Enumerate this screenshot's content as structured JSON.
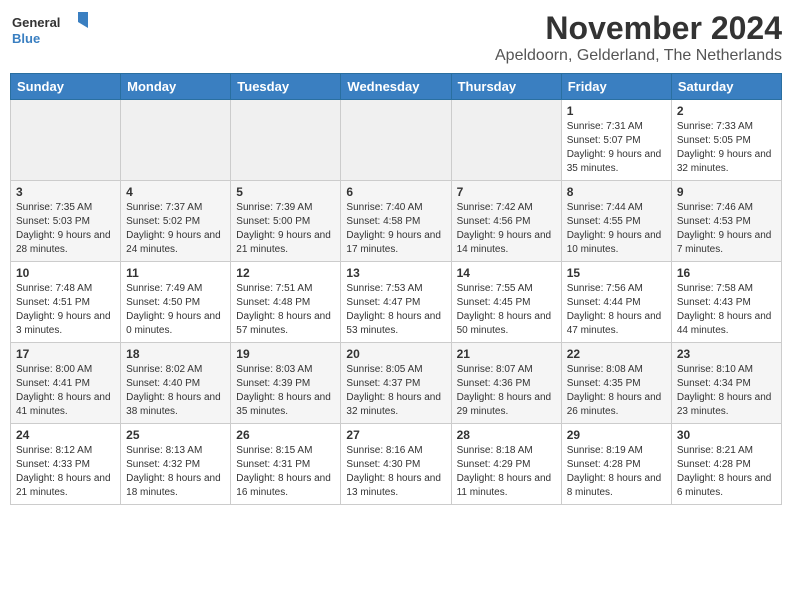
{
  "logo": {
    "line1": "General",
    "line2": "Blue"
  },
  "title": "November 2024",
  "location": "Apeldoorn, Gelderland, The Netherlands",
  "days_of_week": [
    "Sunday",
    "Monday",
    "Tuesday",
    "Wednesday",
    "Thursday",
    "Friday",
    "Saturday"
  ],
  "weeks": [
    [
      {
        "day": "",
        "info": "",
        "empty": true
      },
      {
        "day": "",
        "info": "",
        "empty": true
      },
      {
        "day": "",
        "info": "",
        "empty": true
      },
      {
        "day": "",
        "info": "",
        "empty": true
      },
      {
        "day": "",
        "info": "",
        "empty": true
      },
      {
        "day": "1",
        "info": "Sunrise: 7:31 AM\nSunset: 5:07 PM\nDaylight: 9 hours and 35 minutes."
      },
      {
        "day": "2",
        "info": "Sunrise: 7:33 AM\nSunset: 5:05 PM\nDaylight: 9 hours and 32 minutes."
      }
    ],
    [
      {
        "day": "3",
        "info": "Sunrise: 7:35 AM\nSunset: 5:03 PM\nDaylight: 9 hours and 28 minutes."
      },
      {
        "day": "4",
        "info": "Sunrise: 7:37 AM\nSunset: 5:02 PM\nDaylight: 9 hours and 24 minutes."
      },
      {
        "day": "5",
        "info": "Sunrise: 7:39 AM\nSunset: 5:00 PM\nDaylight: 9 hours and 21 minutes."
      },
      {
        "day": "6",
        "info": "Sunrise: 7:40 AM\nSunset: 4:58 PM\nDaylight: 9 hours and 17 minutes."
      },
      {
        "day": "7",
        "info": "Sunrise: 7:42 AM\nSunset: 4:56 PM\nDaylight: 9 hours and 14 minutes."
      },
      {
        "day": "8",
        "info": "Sunrise: 7:44 AM\nSunset: 4:55 PM\nDaylight: 9 hours and 10 minutes."
      },
      {
        "day": "9",
        "info": "Sunrise: 7:46 AM\nSunset: 4:53 PM\nDaylight: 9 hours and 7 minutes."
      }
    ],
    [
      {
        "day": "10",
        "info": "Sunrise: 7:48 AM\nSunset: 4:51 PM\nDaylight: 9 hours and 3 minutes."
      },
      {
        "day": "11",
        "info": "Sunrise: 7:49 AM\nSunset: 4:50 PM\nDaylight: 9 hours and 0 minutes."
      },
      {
        "day": "12",
        "info": "Sunrise: 7:51 AM\nSunset: 4:48 PM\nDaylight: 8 hours and 57 minutes."
      },
      {
        "day": "13",
        "info": "Sunrise: 7:53 AM\nSunset: 4:47 PM\nDaylight: 8 hours and 53 minutes."
      },
      {
        "day": "14",
        "info": "Sunrise: 7:55 AM\nSunset: 4:45 PM\nDaylight: 8 hours and 50 minutes."
      },
      {
        "day": "15",
        "info": "Sunrise: 7:56 AM\nSunset: 4:44 PM\nDaylight: 8 hours and 47 minutes."
      },
      {
        "day": "16",
        "info": "Sunrise: 7:58 AM\nSunset: 4:43 PM\nDaylight: 8 hours and 44 minutes."
      }
    ],
    [
      {
        "day": "17",
        "info": "Sunrise: 8:00 AM\nSunset: 4:41 PM\nDaylight: 8 hours and 41 minutes."
      },
      {
        "day": "18",
        "info": "Sunrise: 8:02 AM\nSunset: 4:40 PM\nDaylight: 8 hours and 38 minutes."
      },
      {
        "day": "19",
        "info": "Sunrise: 8:03 AM\nSunset: 4:39 PM\nDaylight: 8 hours and 35 minutes."
      },
      {
        "day": "20",
        "info": "Sunrise: 8:05 AM\nSunset: 4:37 PM\nDaylight: 8 hours and 32 minutes."
      },
      {
        "day": "21",
        "info": "Sunrise: 8:07 AM\nSunset: 4:36 PM\nDaylight: 8 hours and 29 minutes."
      },
      {
        "day": "22",
        "info": "Sunrise: 8:08 AM\nSunset: 4:35 PM\nDaylight: 8 hours and 26 minutes."
      },
      {
        "day": "23",
        "info": "Sunrise: 8:10 AM\nSunset: 4:34 PM\nDaylight: 8 hours and 23 minutes."
      }
    ],
    [
      {
        "day": "24",
        "info": "Sunrise: 8:12 AM\nSunset: 4:33 PM\nDaylight: 8 hours and 21 minutes."
      },
      {
        "day": "25",
        "info": "Sunrise: 8:13 AM\nSunset: 4:32 PM\nDaylight: 8 hours and 18 minutes."
      },
      {
        "day": "26",
        "info": "Sunrise: 8:15 AM\nSunset: 4:31 PM\nDaylight: 8 hours and 16 minutes."
      },
      {
        "day": "27",
        "info": "Sunrise: 8:16 AM\nSunset: 4:30 PM\nDaylight: 8 hours and 13 minutes."
      },
      {
        "day": "28",
        "info": "Sunrise: 8:18 AM\nSunset: 4:29 PM\nDaylight: 8 hours and 11 minutes."
      },
      {
        "day": "29",
        "info": "Sunrise: 8:19 AM\nSunset: 4:28 PM\nDaylight: 8 hours and 8 minutes."
      },
      {
        "day": "30",
        "info": "Sunrise: 8:21 AM\nSunset: 4:28 PM\nDaylight: 8 hours and 6 minutes."
      }
    ]
  ]
}
